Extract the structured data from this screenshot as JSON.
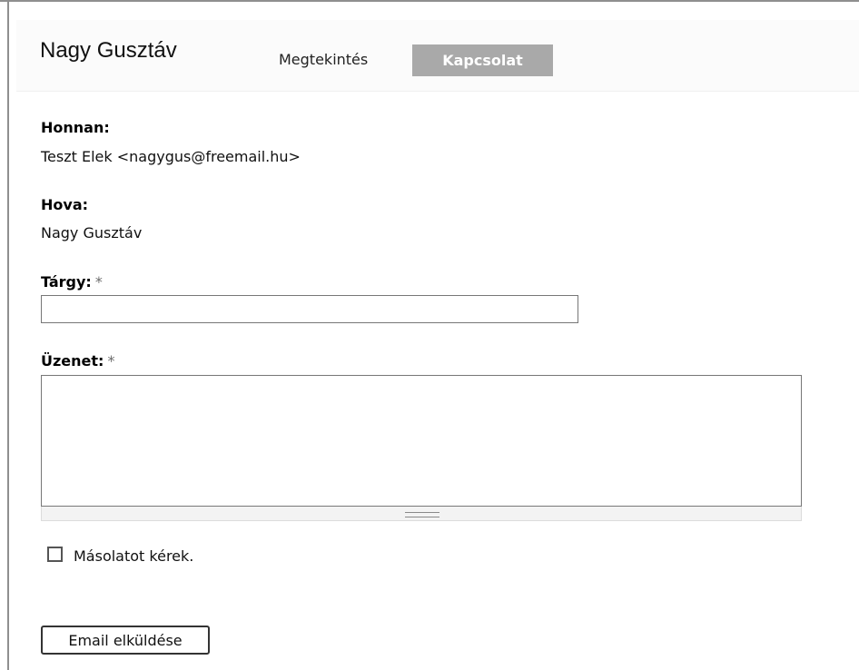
{
  "header": {
    "user_name": "Nagy Gusztáv",
    "tabs": [
      {
        "label": "Megtekintés",
        "active": false
      },
      {
        "label": "Kapcsolat",
        "active": true
      }
    ]
  },
  "form": {
    "from": {
      "label": "Honnan:",
      "value": "Teszt Elek <nagygus@freemail.hu>"
    },
    "to": {
      "label": "Hova:",
      "value": "Nagy Gusztáv"
    },
    "subject": {
      "label": "Tárgy:",
      "required_mark": "*",
      "value": ""
    },
    "message": {
      "label": "Üzenet:",
      "required_mark": "*",
      "value": ""
    },
    "copy_checkbox": {
      "label": "Másolatot kérek.",
      "checked": false
    },
    "submit_label": "Email elküldése"
  },
  "colors": {
    "active_tab_bg": "#a9a9a9",
    "frame_border": "#8f8f8f",
    "required_mark": "#6c6c6c"
  }
}
